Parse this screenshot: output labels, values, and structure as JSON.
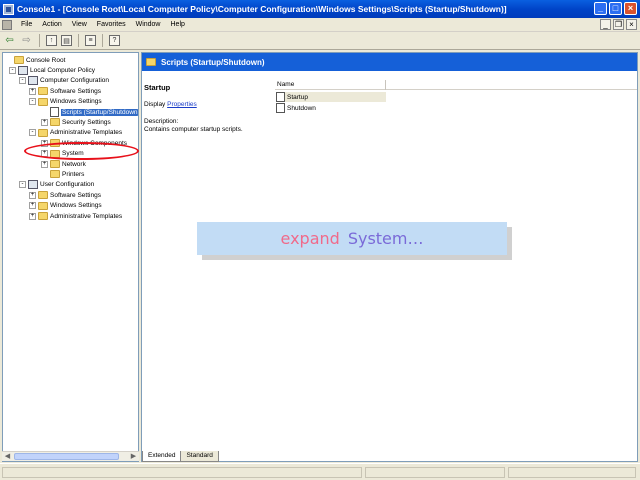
{
  "window": {
    "title": "Console1 - [Console Root\\Local Computer Policy\\Computer Configuration\\Windows Settings\\Scripts (Startup/Shutdown)]",
    "min": "_",
    "max": "□",
    "close": "×"
  },
  "menu": [
    "File",
    "Action",
    "View",
    "Favorites",
    "Window",
    "Help"
  ],
  "child_buttons": [
    "_",
    "❐",
    "×"
  ],
  "toolbar": [
    "back-icon",
    "forward-icon",
    "up-folder-icon",
    "show-tree-icon",
    "export-icon",
    "help-icon"
  ],
  "tree": [
    {
      "label": "Console Root",
      "depth": 0,
      "icon": "folder",
      "expander": ""
    },
    {
      "label": "Local Computer Policy",
      "depth": 1,
      "icon": "computer",
      "expander": "-"
    },
    {
      "label": "Computer Configuration",
      "depth": 2,
      "icon": "computer",
      "expander": "-"
    },
    {
      "label": "Software Settings",
      "depth": 3,
      "icon": "folder",
      "expander": "+"
    },
    {
      "label": "Windows Settings",
      "depth": 3,
      "icon": "folder",
      "expander": "-"
    },
    {
      "label": "Scripts (Startup/Shutdown)",
      "depth": 4,
      "icon": "doc",
      "expander": "",
      "selected": true
    },
    {
      "label": "Security Settings",
      "depth": 4,
      "icon": "folder",
      "expander": "+"
    },
    {
      "label": "Administrative Templates",
      "depth": 3,
      "icon": "folder",
      "expander": "-"
    },
    {
      "label": "Windows Components",
      "depth": 4,
      "icon": "folder",
      "expander": "+"
    },
    {
      "label": "System",
      "depth": 4,
      "icon": "folder",
      "expander": "+"
    },
    {
      "label": "Network",
      "depth": 4,
      "icon": "folder",
      "expander": "+"
    },
    {
      "label": "Printers",
      "depth": 4,
      "icon": "folder",
      "expander": ""
    },
    {
      "label": "User Configuration",
      "depth": 2,
      "icon": "computer",
      "expander": "-"
    },
    {
      "label": "Software Settings",
      "depth": 3,
      "icon": "folder",
      "expander": "+"
    },
    {
      "label": "Windows Settings",
      "depth": 3,
      "icon": "folder",
      "expander": "+"
    },
    {
      "label": "Administrative Templates",
      "depth": 3,
      "icon": "folder",
      "expander": "+"
    }
  ],
  "right": {
    "header": "Scripts (Startup/Shutdown)",
    "desc_title": "Startup",
    "display_prefix": "Display",
    "display_link": "Properties",
    "description_label": "Description:",
    "description_text": "Contains computer startup scripts.",
    "column_name": "Name",
    "items": [
      "Startup",
      "Shutdown"
    ]
  },
  "tabs": [
    "Extended",
    "Standard"
  ],
  "overlay": {
    "word1": "expand",
    "word2": "System…"
  },
  "colors": {
    "titlebar": "#0044c8",
    "header": "#1560d8",
    "highlight_circle": "#e8101a"
  }
}
